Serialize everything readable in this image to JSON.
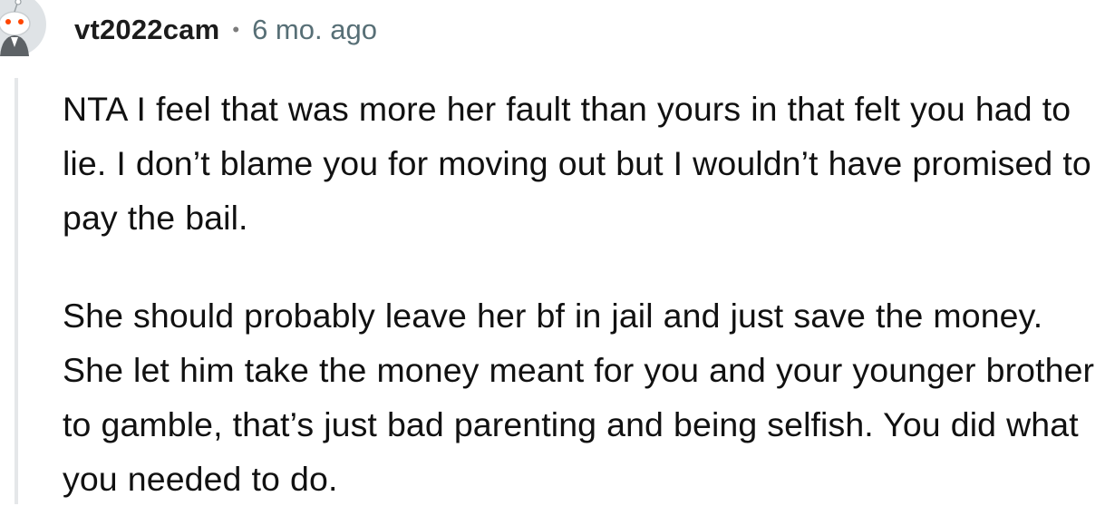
{
  "comment": {
    "author": "vt2022cam",
    "separator": "•",
    "age": "6 mo. ago",
    "avatar_icon": "snoo-avatar-icon",
    "paragraphs": [
      "NTA I feel that was more her fault than yours in that felt you had to lie. I don’t blame you for moving out but I wouldn’t have promised to pay the bail.",
      "She should probably leave her bf in jail and just save the money. She let him take the money meant for you and your younger brother to gamble, that’s just bad parenting and being selfish. You did what you needed to do."
    ]
  },
  "colors": {
    "username": "#1c1c1c",
    "meta": "#576f76",
    "body_text": "#111111",
    "thread_line": "#e5e7e9",
    "avatar_eye": "#ff4500"
  }
}
